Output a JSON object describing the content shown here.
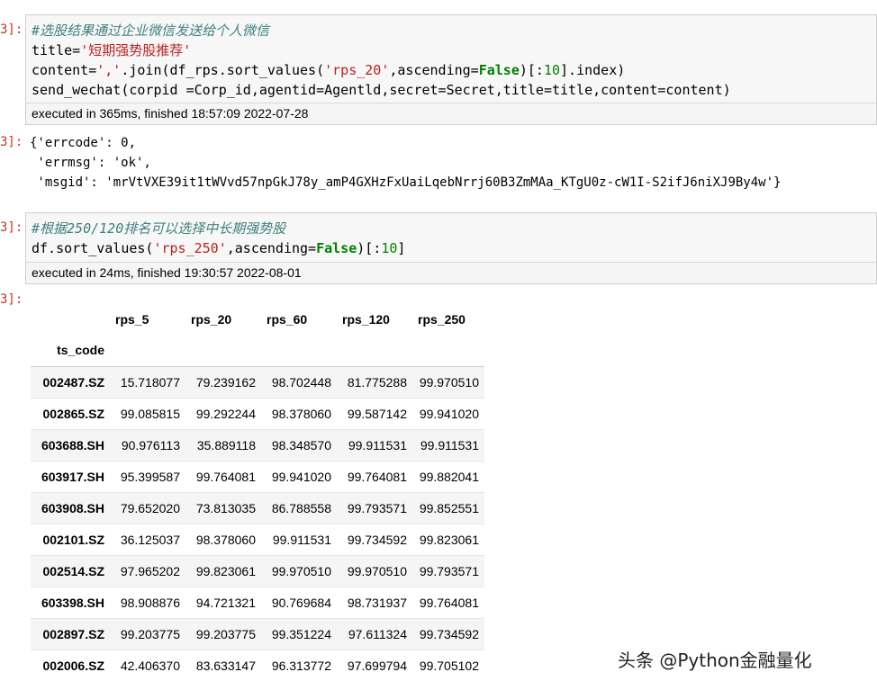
{
  "cells": {
    "c1": {
      "prompt": "3]:",
      "comment": "#选股结果通过企业微信发送给个人微信",
      "line2_pre": "title=",
      "line2_str": "'短期强势股推荐'",
      "line3_pre": "content=",
      "line3_str1": "','",
      "line3_mid": ".join(df_rps.sort_values(",
      "line3_str2": "'rps_20'",
      "line3_mid2": ",ascending=",
      "line3_kw": "False",
      "line3_post1": ")[:",
      "line3_num": "10",
      "line3_post2": "].index)",
      "line4": "send_wechat(corpid =Corp_id,agentid=Agentld,secret=Secret,title=title,content=content)",
      "exec": "executed in 365ms, finished 18:57:09 2022-07-28"
    },
    "o1": {
      "prompt": "3]:",
      "line1": "{'errcode': 0,",
      "line2": " 'errmsg': 'ok',",
      "line3": " 'msgid': 'mrVtVXE39it1tWVvd57npGkJ78y_amP4GXHzFxUaiLqebNrrj60B3ZmMAa_KTgU0z-cW1I-S2ifJ6niXJ9By4w'}"
    },
    "c2": {
      "prompt": "3]:",
      "comment": "#根据250/120排名可以选择中长期强势股",
      "line2_pre": "df.sort_values(",
      "line2_str": "'rps_250'",
      "line2_mid": ",ascending=",
      "line2_kw": "False",
      "line2_post1": ")[:",
      "line2_num": "10",
      "line2_post2": "]",
      "exec": "executed in 24ms, finished 19:30:57 2022-08-01"
    },
    "o2": {
      "prompt": "3]:"
    }
  },
  "table": {
    "columns": [
      "rps_5",
      "rps_20",
      "rps_60",
      "rps_120",
      "rps_250"
    ],
    "index_name": "ts_code",
    "rows": [
      {
        "code": "002487.SZ",
        "vals": [
          "15.718077",
          "79.239162",
          "98.702448",
          "81.775288",
          "99.970510"
        ]
      },
      {
        "code": "002865.SZ",
        "vals": [
          "99.085815",
          "99.292244",
          "98.378060",
          "99.587142",
          "99.941020"
        ]
      },
      {
        "code": "603688.SH",
        "vals": [
          "90.976113",
          "35.889118",
          "98.348570",
          "99.911531",
          "99.911531"
        ]
      },
      {
        "code": "603917.SH",
        "vals": [
          "95.399587",
          "99.764081",
          "99.941020",
          "99.764081",
          "99.882041"
        ]
      },
      {
        "code": "603908.SH",
        "vals": [
          "79.652020",
          "73.813035",
          "86.788558",
          "99.793571",
          "99.852551"
        ]
      },
      {
        "code": "002101.SZ",
        "vals": [
          "36.125037",
          "98.378060",
          "99.911531",
          "99.734592",
          "99.823061"
        ]
      },
      {
        "code": "002514.SZ",
        "vals": [
          "97.965202",
          "99.823061",
          "99.970510",
          "99.970510",
          "99.793571"
        ]
      },
      {
        "code": "603398.SH",
        "vals": [
          "98.908876",
          "94.721321",
          "90.769684",
          "98.731937",
          "99.764081"
        ]
      },
      {
        "code": "002897.SZ",
        "vals": [
          "99.203775",
          "99.203775",
          "99.351224",
          "97.611324",
          "99.734592"
        ]
      },
      {
        "code": "002006.SZ",
        "vals": [
          "42.406370",
          "83.633147",
          "96.313772",
          "97.699794",
          "99.705102"
        ]
      }
    ]
  },
  "watermark": "头条 @Python金融量化"
}
